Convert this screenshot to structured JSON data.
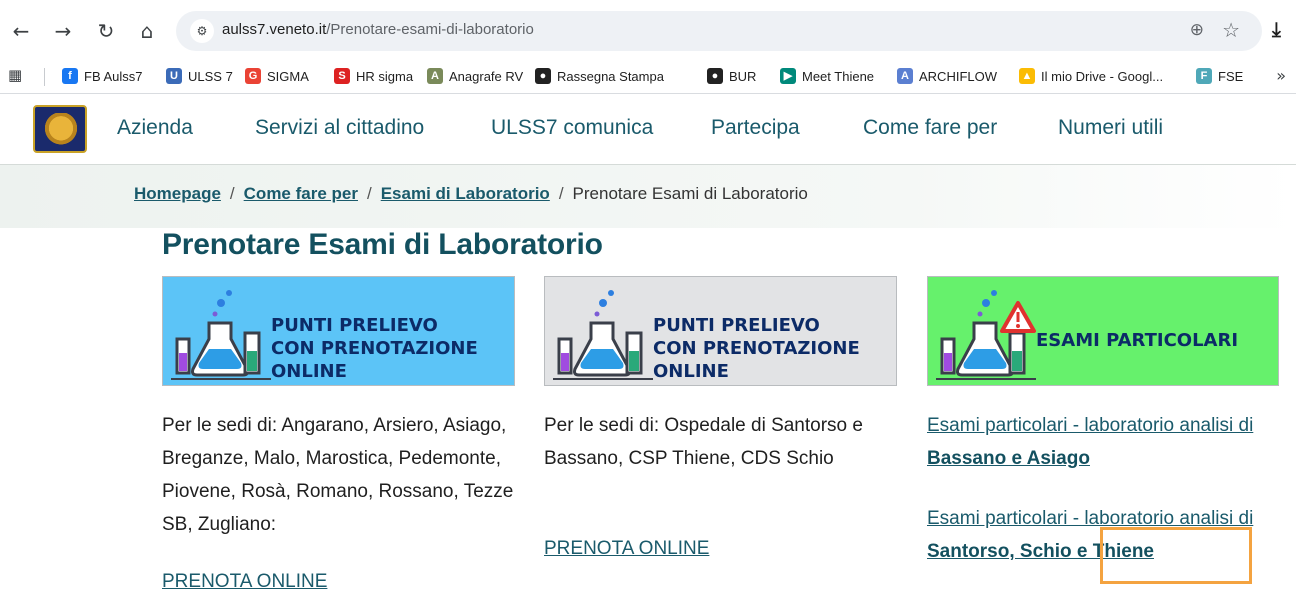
{
  "browser": {
    "url_host": "aulss7.veneto.it",
    "url_path": "/Prenotare-esami-di-laboratorio",
    "bookmarks": [
      {
        "label": "FB Aulss7",
        "icon": "facebook-icon",
        "color": "#1877f2"
      },
      {
        "label": "ULSS 7",
        "icon": "ulss-icon",
        "color": "#3b6bb8"
      },
      {
        "label": "SIGMA",
        "icon": "google-icon",
        "color": "#ea4335"
      },
      {
        "label": "HR sigma",
        "icon": "s-icon",
        "color": "#d22"
      },
      {
        "label": "Anagrafe RV",
        "icon": "anagrafe-icon",
        "color": "#7a8a5a"
      },
      {
        "label": "Rassegna Stampa",
        "icon": "globe-icon",
        "color": "#222"
      },
      {
        "label": "BUR",
        "icon": "globe-icon",
        "color": "#222"
      },
      {
        "label": "Meet  Thiene",
        "icon": "meet-icon",
        "color": "#00897b"
      },
      {
        "label": "ARCHIFLOW",
        "icon": "archiflow-icon",
        "color": "#5b7fd1"
      },
      {
        "label": "Il mio Drive - Googl...",
        "icon": "drive-icon",
        "color": "#fbbc04"
      },
      {
        "label": "FSE",
        "icon": "fse-icon",
        "color": "#4fa8b8"
      }
    ]
  },
  "menu": [
    "Azienda",
    "Servizi al cittadino",
    "ULSS7 comunica",
    "Partecipa",
    "Come fare per",
    "Numeri utili"
  ],
  "breadcrumb": {
    "items": [
      "Homepage",
      "Come fare per",
      "Esami di Laboratorio"
    ],
    "current": "Prenotare Esami di Laboratorio",
    "separator": "/"
  },
  "page": {
    "title": "Prenotare Esami di Laboratorio",
    "cards": [
      {
        "banner_lines": [
          "PUNTI PRELIEVO",
          "CON PRENOTAZIONE",
          "ONLINE"
        ],
        "banner_color": "#5cc4f7",
        "text": "Per le sedi di: Angarano, Arsiero, Asiago, Breganze, Malo, Marostica, Pedemonte, Piovene, Rosà, Romano, Rossano, Tezze SB, Zugliano:",
        "link": "PRENOTA ONLINE"
      },
      {
        "banner_lines": [
          "PUNTI PRELIEVO",
          "CON PRENOTAZIONE",
          "ONLINE"
        ],
        "banner_color": "#e2e3e5",
        "text": "Per le sedi di: Ospedale di Santorso e Bassano, CSP Thiene, CDS Schio",
        "link": "PRENOTA ONLINE"
      },
      {
        "banner_lines": [
          "ESAMI PARTICOLARI"
        ],
        "banner_color": "#66f16c",
        "links": [
          {
            "prefix": "Esami particolari - laboratorio analisi di ",
            "bold": "Bassano e Asiago"
          },
          {
            "prefix": "Esami particolari - laboratorio analisi di ",
            "bold": "Santorso, Schio e Thiene"
          }
        ]
      }
    ]
  }
}
